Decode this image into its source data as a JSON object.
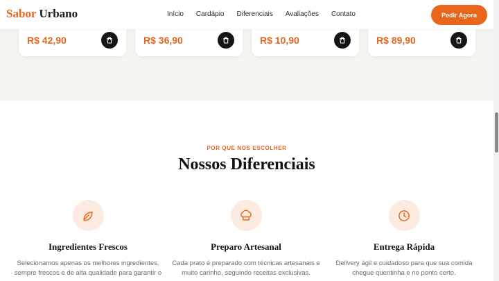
{
  "brand": {
    "name_part1": "Sabor",
    "name_part2": "Urbano"
  },
  "nav": {
    "links": [
      "Início",
      "Cardápio",
      "Diferenciais",
      "Avaliações",
      "Contato"
    ],
    "cta_label": "Pedir Agora"
  },
  "products": [
    {
      "price": "R$ 42,90"
    },
    {
      "price": "R$ 36,90"
    },
    {
      "price": "R$ 10,90"
    },
    {
      "price": "R$ 89,90"
    }
  ],
  "differentials": {
    "eyebrow": "POR QUE NOS ESCOLHER",
    "title": "Nossos Diferenciais",
    "items": [
      {
        "icon": "leaf-icon",
        "title": "Ingredientes Frescos",
        "description": "Selecionamos apenas os melhores ingredientes, sempre frescos e de alta qualidade para garantir o"
      },
      {
        "icon": "chef-hat-icon",
        "title": "Preparo Artesanal",
        "description": "Cada prato é preparado com técnicas artesanais e muito carinho, seguindo receitas exclusivas."
      },
      {
        "icon": "clock-icon",
        "title": "Entrega Rápida",
        "description": "Delivery ágil e cuidadoso para que sua comida chegue quentinha e no ponto certo."
      }
    ]
  },
  "colors": {
    "accent": "#e8651c",
    "cream": "#f6f4f0",
    "icon_bg": "#fdeae0",
    "dark": "#151515"
  }
}
